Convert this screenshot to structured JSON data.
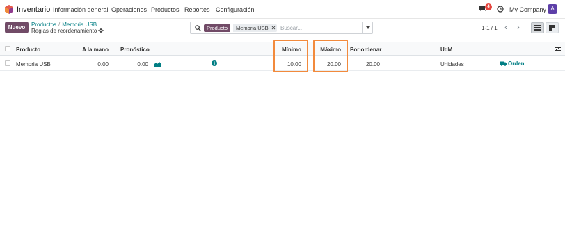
{
  "navbar": {
    "app_name": "Inventario",
    "menu": [
      "Información general",
      "Operaciones",
      "Productos",
      "Reportes",
      "Configuración"
    ],
    "chat_count": "4",
    "company": "My Company",
    "avatar_letter": "A"
  },
  "control": {
    "new_button": "Nuevo",
    "breadcrumb": [
      "Productos",
      "Memoria USB"
    ],
    "current": "Reglas de reordenamiento"
  },
  "search": {
    "facet_label": "Producto",
    "facet_value": "Memoria USB",
    "remove_symbol": "✕",
    "placeholder": "Buscar..."
  },
  "pager": {
    "value": "1-1 / 1",
    "prev": "‹",
    "next": "›"
  },
  "table": {
    "columns": [
      "Producto",
      "A la mano",
      "Pronóstico",
      "Mínimo",
      "Máximo",
      "Por ordenar",
      "UdM"
    ],
    "rows": [
      {
        "product": "Memoria USB",
        "on_hand": "0.00",
        "forecast": "0.00",
        "minimum": "10.00",
        "maximum": "20.00",
        "to_order": "20.00",
        "uom": "Unidades",
        "action": "Orden"
      }
    ]
  },
  "colors": {
    "brand": "#714b67",
    "link": "#017e84",
    "highlight": "#f28a3c",
    "badge": "#e4453d"
  }
}
